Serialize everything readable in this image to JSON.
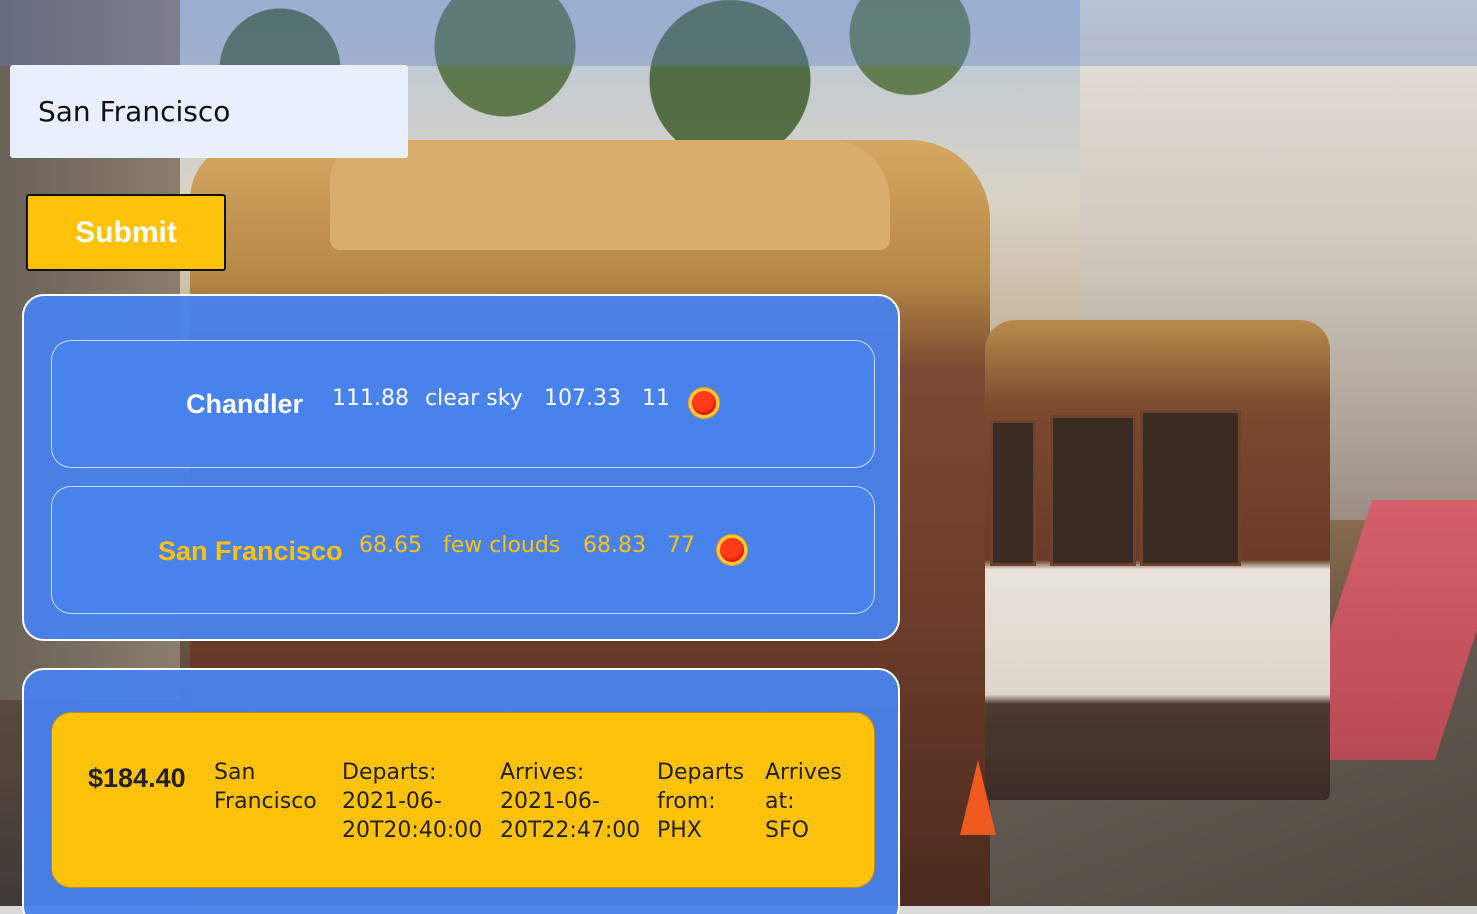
{
  "search": {
    "value": "San Francisco",
    "submit_label": "Submit"
  },
  "weather": [
    {
      "city": "Chandler",
      "temp": "111.88",
      "description": "clear sky",
      "feels_like": "107.33",
      "humidity": "11",
      "icon": "sun-icon"
    },
    {
      "city": "San Francisco",
      "temp": "68.65",
      "description": "few clouds",
      "feels_like": "68.83",
      "humidity": "77",
      "icon": "sun-icon"
    }
  ],
  "flights": [
    {
      "price": "$184.40",
      "destination": [
        "San",
        "Francisco"
      ],
      "departs": [
        "Departs:",
        "2021-06-",
        "20T20:40:00"
      ],
      "arrives": [
        "Arrives:",
        "2021-06-",
        "20T22:47:00"
      ],
      "departs_from": [
        "Departs",
        "from:",
        "PHX"
      ],
      "arrives_at": [
        "Arrives",
        "at:",
        "SFO"
      ]
    }
  ],
  "colors": {
    "panel_blue": "#4882ec",
    "accent_gold": "#ffc20a",
    "input_bg": "#e8f0fe"
  }
}
